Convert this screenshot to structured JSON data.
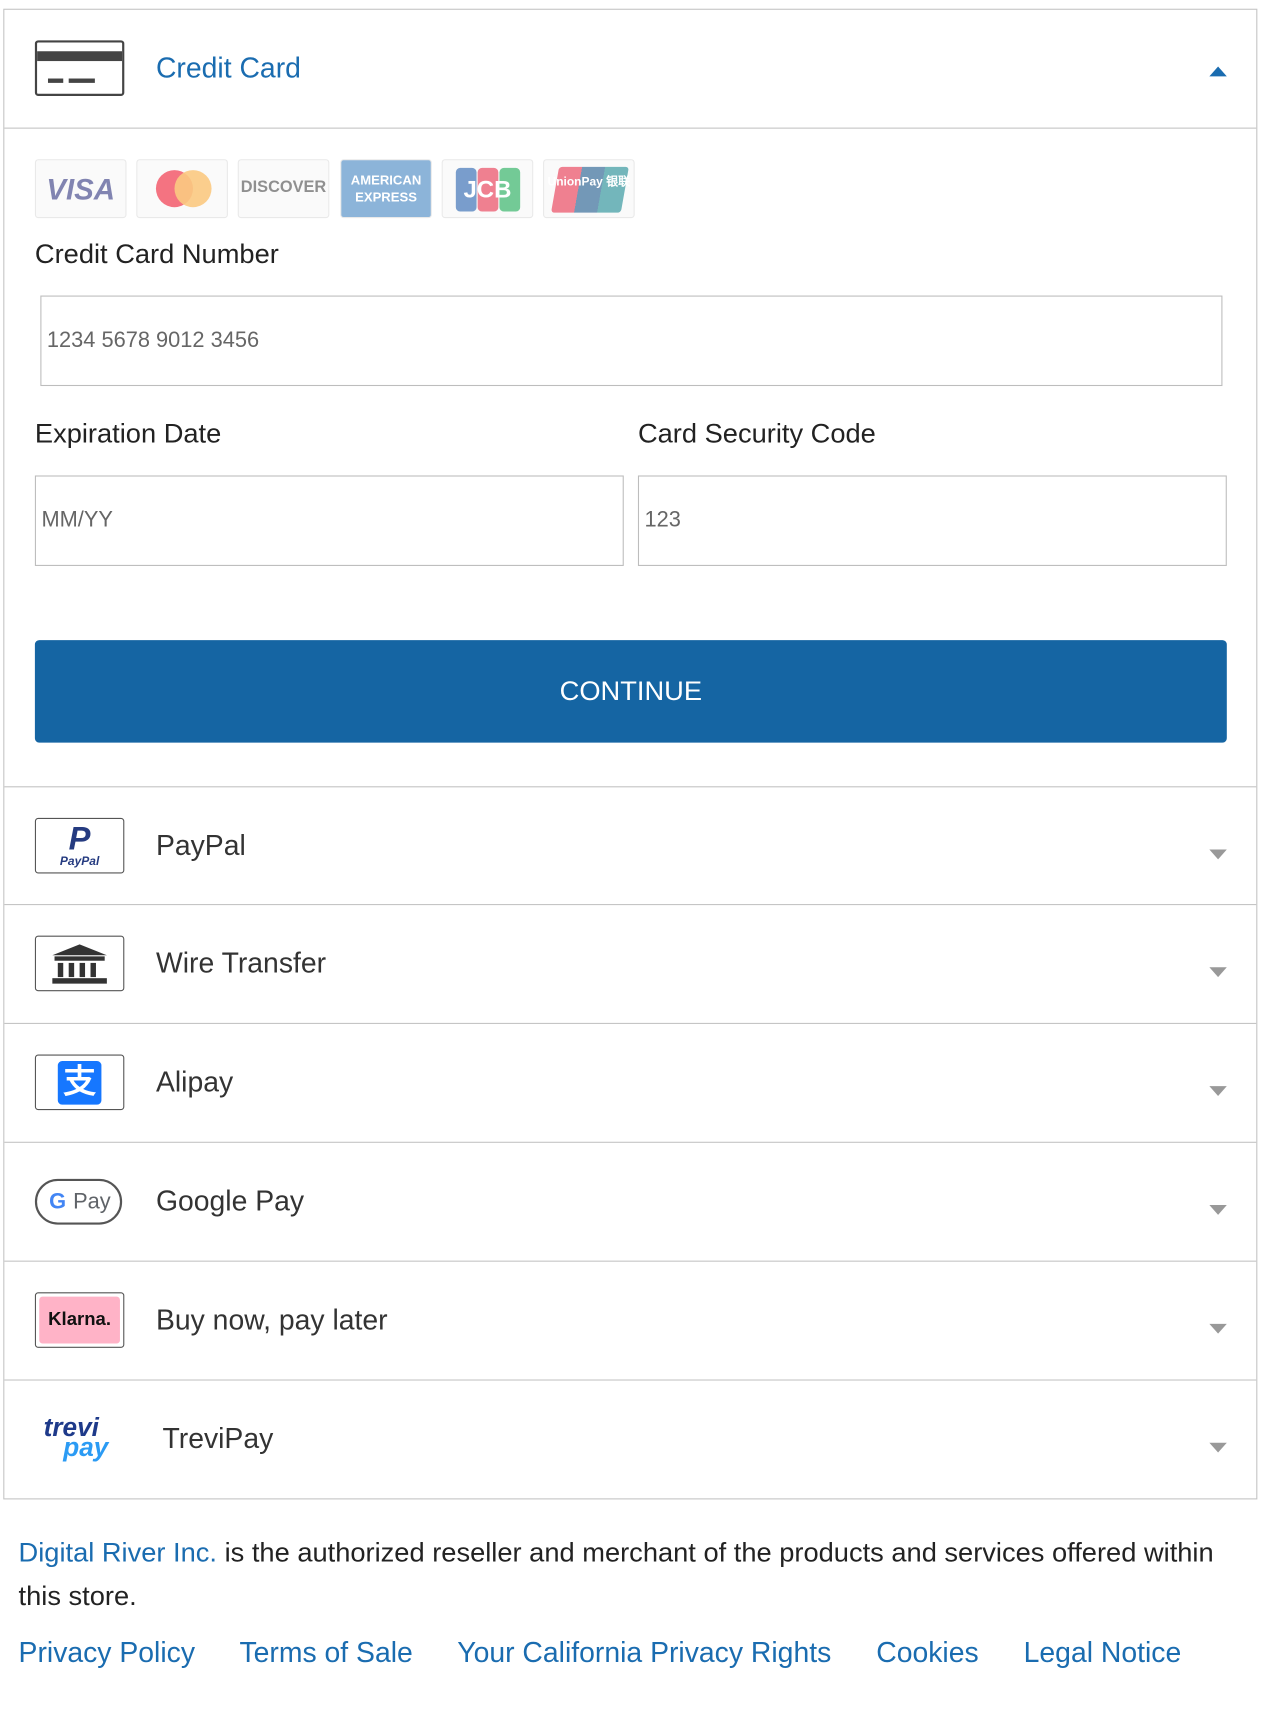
{
  "credit_card": {
    "title": "Credit Card",
    "brands": [
      "VISA",
      "mastercard",
      "DISCOVER",
      "AMERICAN EXPRESS",
      "JCB",
      "UnionPay 银联"
    ],
    "card_number_label": "Credit Card Number",
    "card_number_placeholder": "1234 5678 9012 3456",
    "expiration_label": "Expiration Date",
    "expiration_placeholder": "MM/YY",
    "security_label": "Card Security Code",
    "security_placeholder": "123",
    "continue_label": "CONTINUE"
  },
  "methods": [
    {
      "label": "PayPal",
      "icon": "paypal-icon",
      "icon_text": "PayPal"
    },
    {
      "label": "Wire Transfer",
      "icon": "bank-icon"
    },
    {
      "label": "Alipay",
      "icon": "alipay-icon",
      "icon_text": "支"
    },
    {
      "label": "Google Pay",
      "icon": "google-pay-icon",
      "icon_text": "Pay",
      "icon_letter": "G"
    },
    {
      "label": "Buy now, pay later",
      "icon": "klarna-icon",
      "icon_text": "Klarna."
    },
    {
      "label": "TreviPay",
      "icon": "trevipay-icon",
      "icon_text": "trevi",
      "icon_text2": "pay"
    }
  ],
  "footer": {
    "merchant_link": "Digital River Inc.",
    "merchant_text": " is the authorized reseller and merchant of the products and services offered within this store.",
    "links": [
      "Privacy Policy",
      "Terms of Sale",
      "Your California Privacy Rights",
      "Cookies",
      "Legal Notice"
    ]
  },
  "colors": {
    "accent": "#1565a3",
    "link": "#1a6cb0",
    "border": "#c4c4c4"
  }
}
